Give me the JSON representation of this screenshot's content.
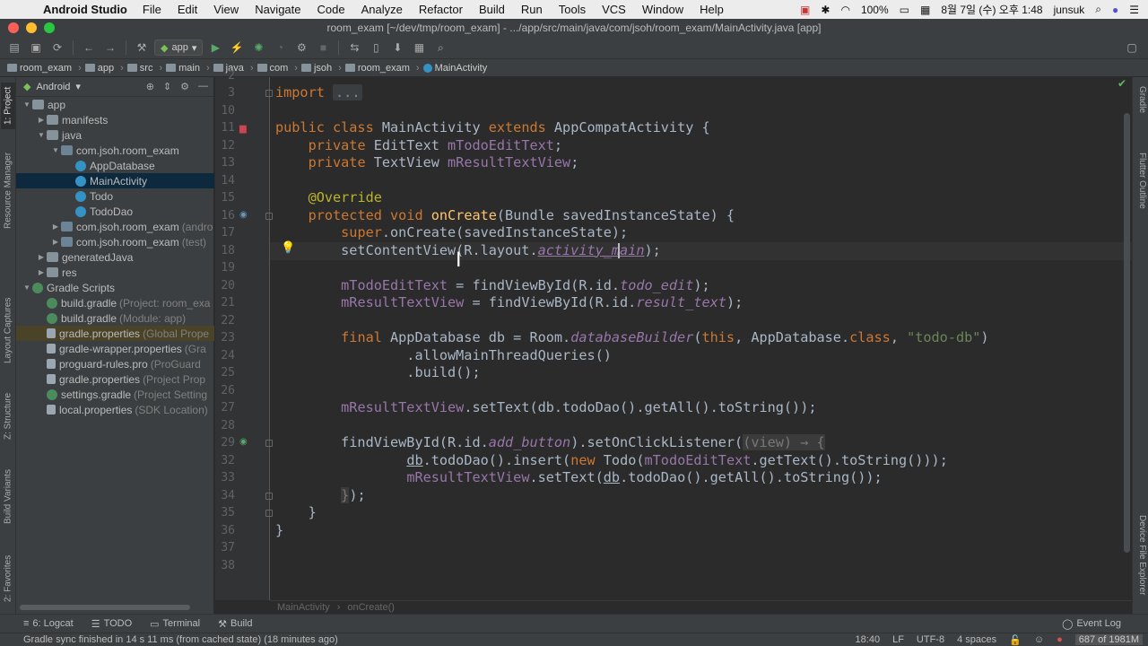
{
  "menubar": {
    "app_name": "Android Studio",
    "items": [
      "File",
      "Edit",
      "View",
      "Navigate",
      "Code",
      "Analyze",
      "Refactor",
      "Build",
      "Run",
      "Tools",
      "VCS",
      "Window",
      "Help"
    ],
    "battery": "100%",
    "clock": "8월 7일 (수) 오후 1:48",
    "user": "junsuk"
  },
  "window": {
    "title": "room_exam [~/dev/tmp/room_exam] - .../app/src/main/java/com/jsoh/room_exam/MainActivity.java [app]"
  },
  "toolbar": {
    "run_config": "app"
  },
  "breadcrumb": [
    "room_exam",
    "app",
    "src",
    "main",
    "java",
    "com",
    "jsoh",
    "room_exam",
    "MainActivity"
  ],
  "project_panel": {
    "view_mode": "Android",
    "tree": [
      {
        "label": "app",
        "sub": "",
        "depth": 0,
        "arrow": "▼",
        "icon": "folder"
      },
      {
        "label": "manifests",
        "sub": "",
        "depth": 1,
        "arrow": "▶",
        "icon": "folder"
      },
      {
        "label": "java",
        "sub": "",
        "depth": 1,
        "arrow": "▼",
        "icon": "folder"
      },
      {
        "label": "com.jsoh.room_exam",
        "sub": "",
        "depth": 2,
        "arrow": "▼",
        "icon": "pkg"
      },
      {
        "label": "AppDatabase",
        "sub": "",
        "depth": 3,
        "arrow": "",
        "icon": "cls"
      },
      {
        "label": "MainActivity",
        "sub": "",
        "depth": 3,
        "arrow": "",
        "icon": "cls",
        "selected": true
      },
      {
        "label": "Todo",
        "sub": "",
        "depth": 3,
        "arrow": "",
        "icon": "cls"
      },
      {
        "label": "TodoDao",
        "sub": "",
        "depth": 3,
        "arrow": "",
        "icon": "cls"
      },
      {
        "label": "com.jsoh.room_exam",
        "sub": "(andro",
        "depth": 2,
        "arrow": "▶",
        "icon": "pkg"
      },
      {
        "label": "com.jsoh.room_exam",
        "sub": "(test)",
        "depth": 2,
        "arrow": "▶",
        "icon": "pkg"
      },
      {
        "label": "generatedJava",
        "sub": "",
        "depth": 1,
        "arrow": "▶",
        "icon": "folder"
      },
      {
        "label": "res",
        "sub": "",
        "depth": 1,
        "arrow": "▶",
        "icon": "folder"
      },
      {
        "label": "Gradle Scripts",
        "sub": "",
        "depth": 0,
        "arrow": "▼",
        "icon": "gradle"
      },
      {
        "label": "build.gradle",
        "sub": "(Project: room_exa",
        "depth": 1,
        "arrow": "",
        "icon": "gradle"
      },
      {
        "label": "build.gradle",
        "sub": "(Module: app)",
        "depth": 1,
        "arrow": "",
        "icon": "gradle"
      },
      {
        "label": "gradle.properties",
        "sub": "(Global Prope",
        "depth": 1,
        "arrow": "",
        "icon": "file",
        "highlight": true
      },
      {
        "label": "gradle-wrapper.properties",
        "sub": "(Gra",
        "depth": 1,
        "arrow": "",
        "icon": "file"
      },
      {
        "label": "proguard-rules.pro",
        "sub": "(ProGuard",
        "depth": 1,
        "arrow": "",
        "icon": "file"
      },
      {
        "label": "gradle.properties",
        "sub": "(Project Prop",
        "depth": 1,
        "arrow": "",
        "icon": "file"
      },
      {
        "label": "settings.gradle",
        "sub": "(Project Setting",
        "depth": 1,
        "arrow": "",
        "icon": "gradle"
      },
      {
        "label": "local.properties",
        "sub": "(SDK Location)",
        "depth": 1,
        "arrow": "",
        "icon": "file"
      }
    ]
  },
  "left_tabs": [
    "1: Project",
    "Resource Manager",
    "Layout Captures",
    "Z: Structure",
    "Build Variants",
    "2: Favorites"
  ],
  "right_tabs": [
    "Gradle",
    "Flutter Outline",
    "Device File Explorer"
  ],
  "editor": {
    "line_numbers": [
      "2",
      "3",
      "10",
      "11",
      "12",
      "13",
      "14",
      "15",
      "16",
      "17",
      "18",
      "19",
      "20",
      "21",
      "22",
      "23",
      "24",
      "25",
      "26",
      "27",
      "28",
      "29",
      "32",
      "33",
      "34",
      "35",
      "36",
      "37",
      "38"
    ],
    "code_breadcrumb": [
      "MainActivity",
      "onCreate()"
    ]
  },
  "bottom_tabs": [
    "6: Logcat",
    "TODO",
    "Terminal",
    "Build"
  ],
  "bottom_right_tab": "Event Log",
  "status": {
    "message": "Gradle sync finished in 14 s 11 ms (from cached state) (18 minutes ago)",
    "position": "18:40",
    "line_sep": "LF",
    "encoding": "UTF-8",
    "indent": "4 spaces",
    "memory": "687 of 1981M"
  },
  "colors": {
    "accent": "#3592c4",
    "keyword": "#cc7832",
    "method": "#ffc66d",
    "field": "#9876aa",
    "string": "#6a8759",
    "annotation": "#bbb529"
  }
}
